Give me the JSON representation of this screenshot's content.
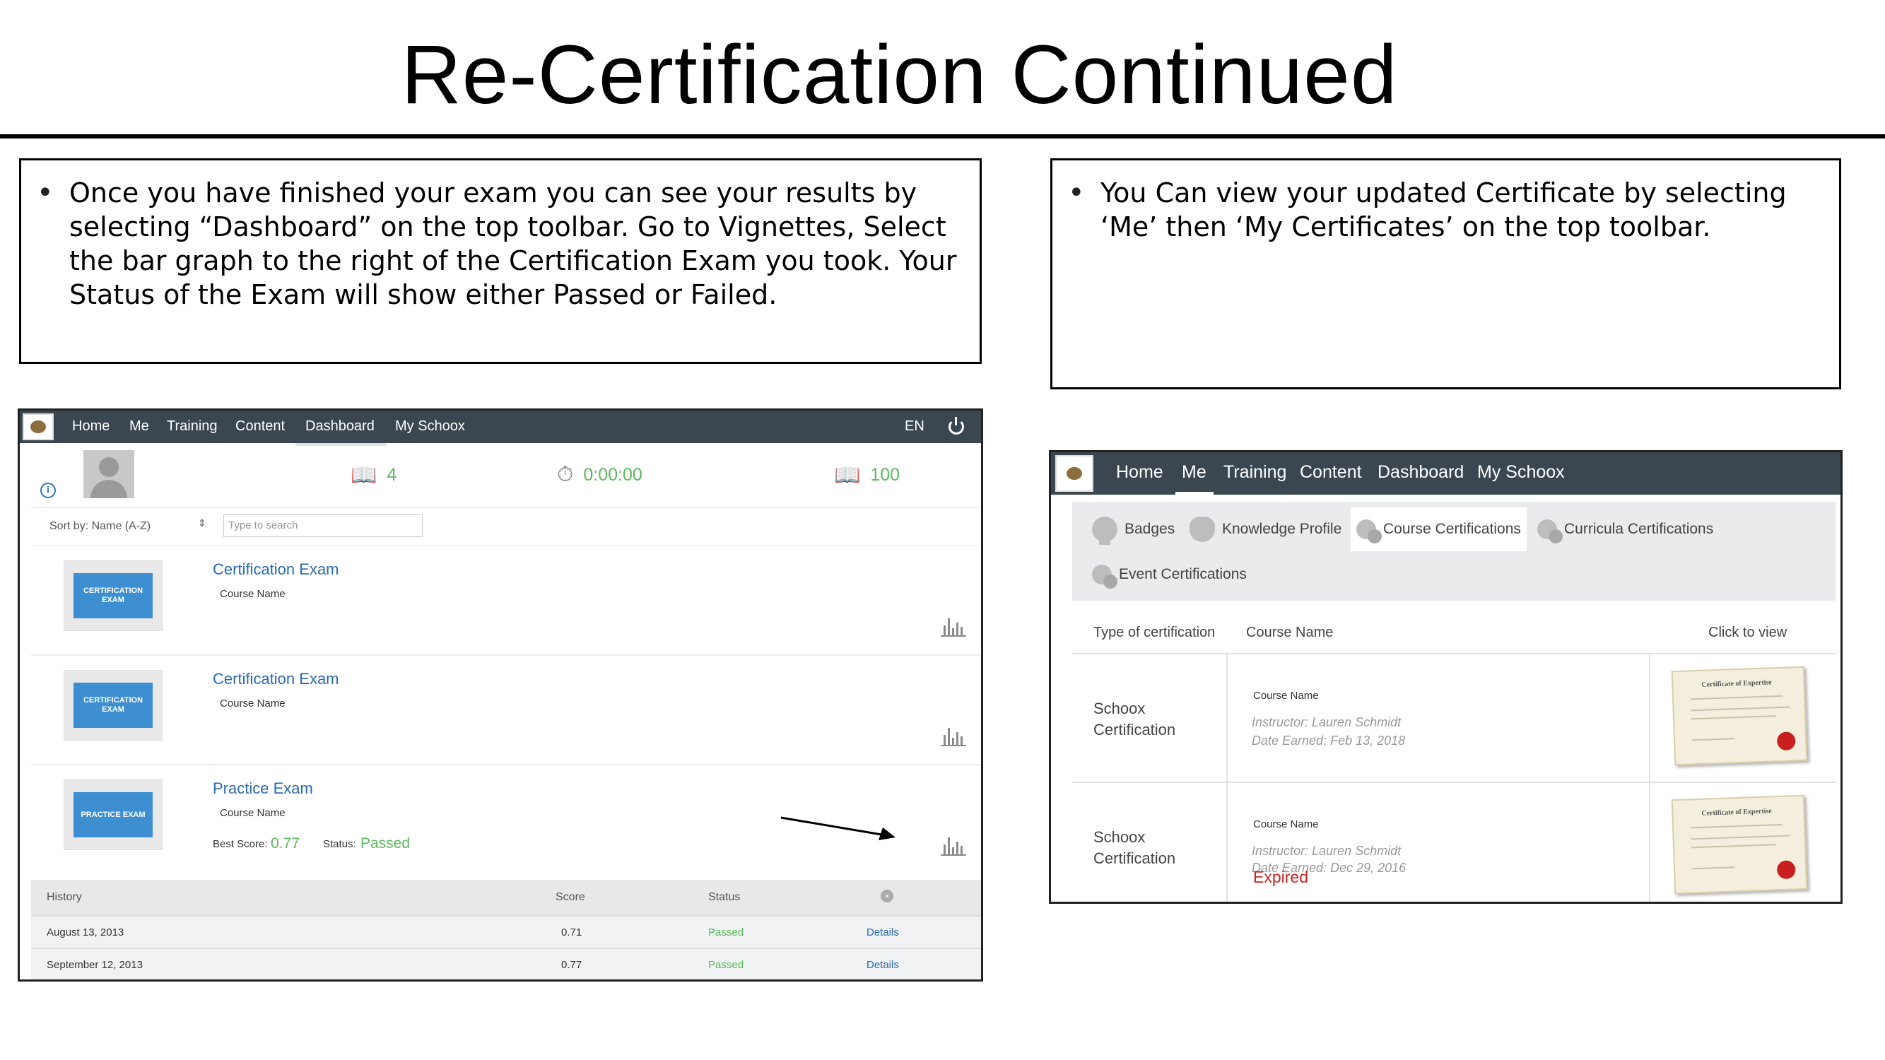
{
  "slide": {
    "title": "Re-Certification Continued",
    "left_note": "Once you have finished your exam you can see your results by selecting “Dashboard” on the top toolbar. Go to Vignettes, Select the bar graph to the right of the Certification Exam you took. Your Status of the Exam will show either Passed or Failed.",
    "right_note": "You Can view your updated Certificate by selecting ‘Me’ then ‘My Certificates’ on the top toolbar.",
    "bullet": "•"
  },
  "dashboard": {
    "nav": [
      "Home",
      "Me",
      "Training",
      "Content",
      "Dashboard",
      "My Schoox"
    ],
    "active_nav": "Dashboard",
    "lang": "EN",
    "stats": {
      "count": "4",
      "time": "0:00:00",
      "points": "100"
    },
    "sort_label": "Sort by: Name (A-Z)",
    "search_placeholder": "Type to search",
    "exams": [
      {
        "thumb": "CERTIFICATION EXAM",
        "title": "Certification Exam",
        "course": "Course Name"
      },
      {
        "thumb": "CERTIFICATION EXAM",
        "title": "Certification Exam",
        "course": "Course Name"
      },
      {
        "thumb": "PRACTICE EXAM",
        "title": "Practice Exam",
        "course": "Course Name",
        "best_score_label": "Best Score:",
        "best_score": "0.77",
        "status_label": "Status:",
        "status": "Passed"
      }
    ],
    "history": {
      "headers": [
        "History",
        "Score",
        "Status"
      ],
      "rows": [
        {
          "date": "August 13, 2013",
          "score": "0.71",
          "status": "Passed",
          "action": "Details"
        },
        {
          "date": "September 12, 2013",
          "score": "0.77",
          "status": "Passed",
          "action": "Details"
        }
      ]
    }
  },
  "certificates": {
    "nav": [
      "Home",
      "Me",
      "Training",
      "Content",
      "Dashboard",
      "My Schoox"
    ],
    "active_nav": "Me",
    "tabs": [
      "Badges",
      "Knowledge Profile",
      "Course Certifications",
      "Curricula Certifications",
      "Event Certifications"
    ],
    "active_tab": "Course Certifications",
    "headers": [
      "Type of certification",
      "Course Name",
      "Click to view"
    ],
    "rows": [
      {
        "type": "Schoox Certification",
        "course": "Course Name",
        "instructor": "Instructor: Lauren Schmidt",
        "earned": "Date Earned: Feb 13, 2018",
        "expired": ""
      },
      {
        "type": "Schoox Certification",
        "course": "Course Name",
        "instructor": "Instructor: Lauren Schmidt",
        "earned": "Date Earned: Dec 29, 2016",
        "expired": "Expired"
      }
    ],
    "cert_image_title": "Certificate of Expertise"
  },
  "colors": {
    "navbar": "#3b4750",
    "accent_green": "#5cb85c",
    "link_blue": "#2a6ab0",
    "expired_red": "#cc2222"
  }
}
